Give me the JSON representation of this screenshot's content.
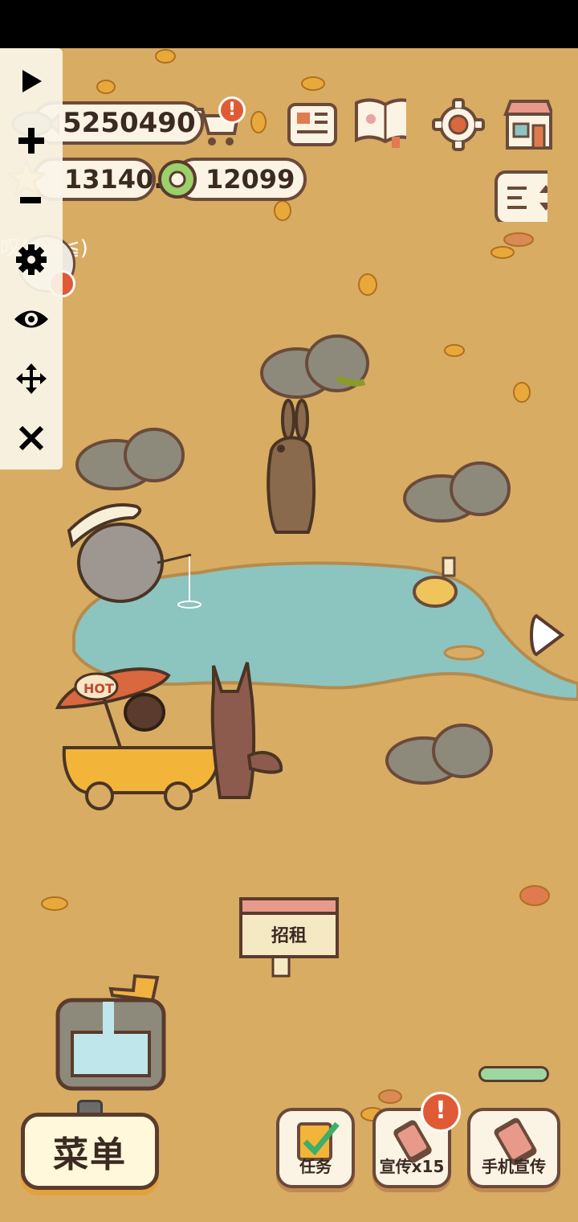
{
  "hud": {
    "fish_amount": "5250490",
    "star_amount": "13140.9",
    "coin_amount": "12099",
    "cat_name_partial": "叹(≧▽≦)"
  },
  "top_icons": [
    "shopping-cart-icon",
    "newspaper-icon",
    "recipe-book-icon",
    "settings-gear-icon",
    "shop-icon",
    "layout-toggle-icon"
  ],
  "toolbar": {
    "items": [
      "play-icon",
      "plus-icon",
      "minus-icon",
      "gear-icon",
      "eye-icon",
      "move-icon",
      "close-icon"
    ]
  },
  "scene": {
    "sign_text": "招租"
  },
  "bottom": {
    "menu_label": "菜单",
    "task_label": "任务",
    "promote_label": "宣传x15",
    "phone_promote_label": "手机宣传",
    "badge_mark": "!"
  },
  "colors": {
    "ground": "#d8ac62",
    "water": "#8cc4c0",
    "outline": "#6b4a3a",
    "badge": "#e05a36"
  }
}
